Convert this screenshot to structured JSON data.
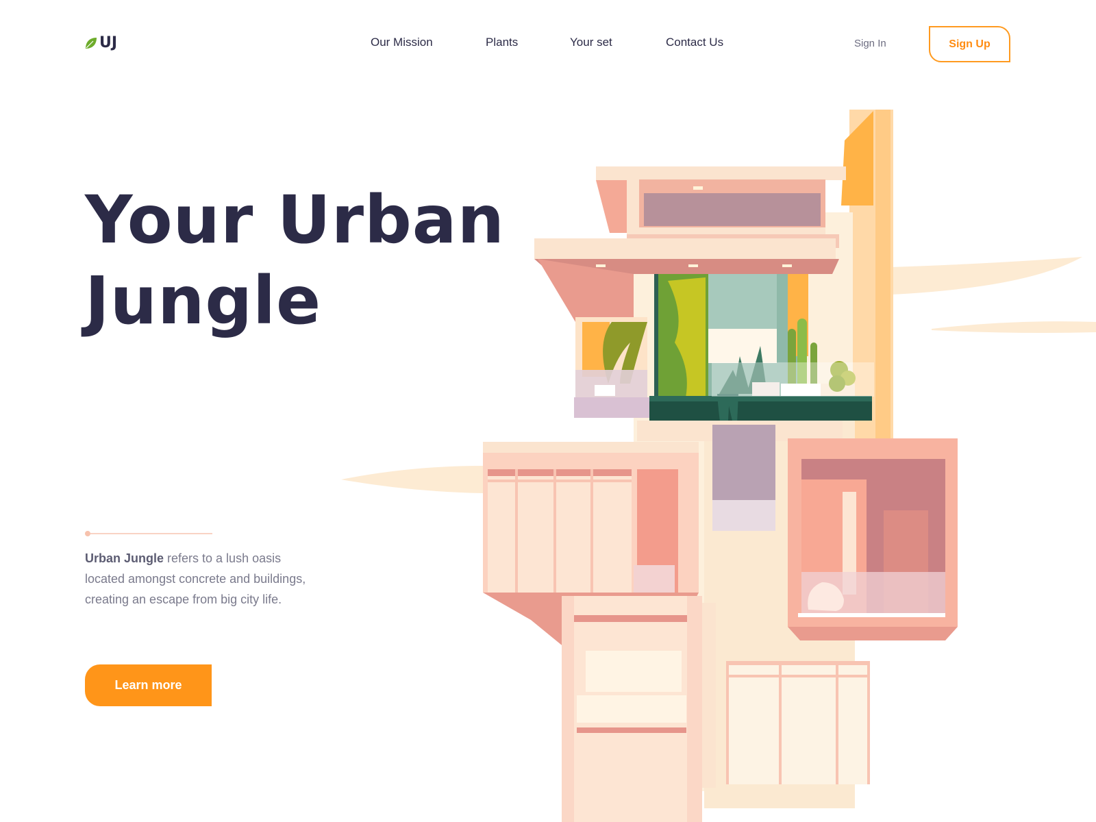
{
  "brand": {
    "logo_text": "UJ",
    "logo_icon": "leaf-icon",
    "leaf_color": "#6dac2b",
    "accent_color": "#ff9519",
    "text_color": "#2c2b47"
  },
  "nav": {
    "items": [
      {
        "label": "Our Mission"
      },
      {
        "label": "Plants"
      },
      {
        "label": "Your set"
      },
      {
        "label": "Contact Us"
      }
    ],
    "sign_in": "Sign In",
    "sign_up": "Sign Up"
  },
  "hero": {
    "title_line1": "Your Urban",
    "title_line2": "Jungle",
    "description_bold": "Urban Jungle",
    "description_rest": " refers to a lush oasis located amongst concrete and buildings, creating an escape from big city life.",
    "cta_label": "Learn more"
  },
  "illustration": {
    "subject": "building-with-plant-balconies-illustration",
    "palette": [
      "#fbd7c6",
      "#f6a996",
      "#ffe7cf",
      "#2d5f53",
      "#ffb347"
    ]
  }
}
